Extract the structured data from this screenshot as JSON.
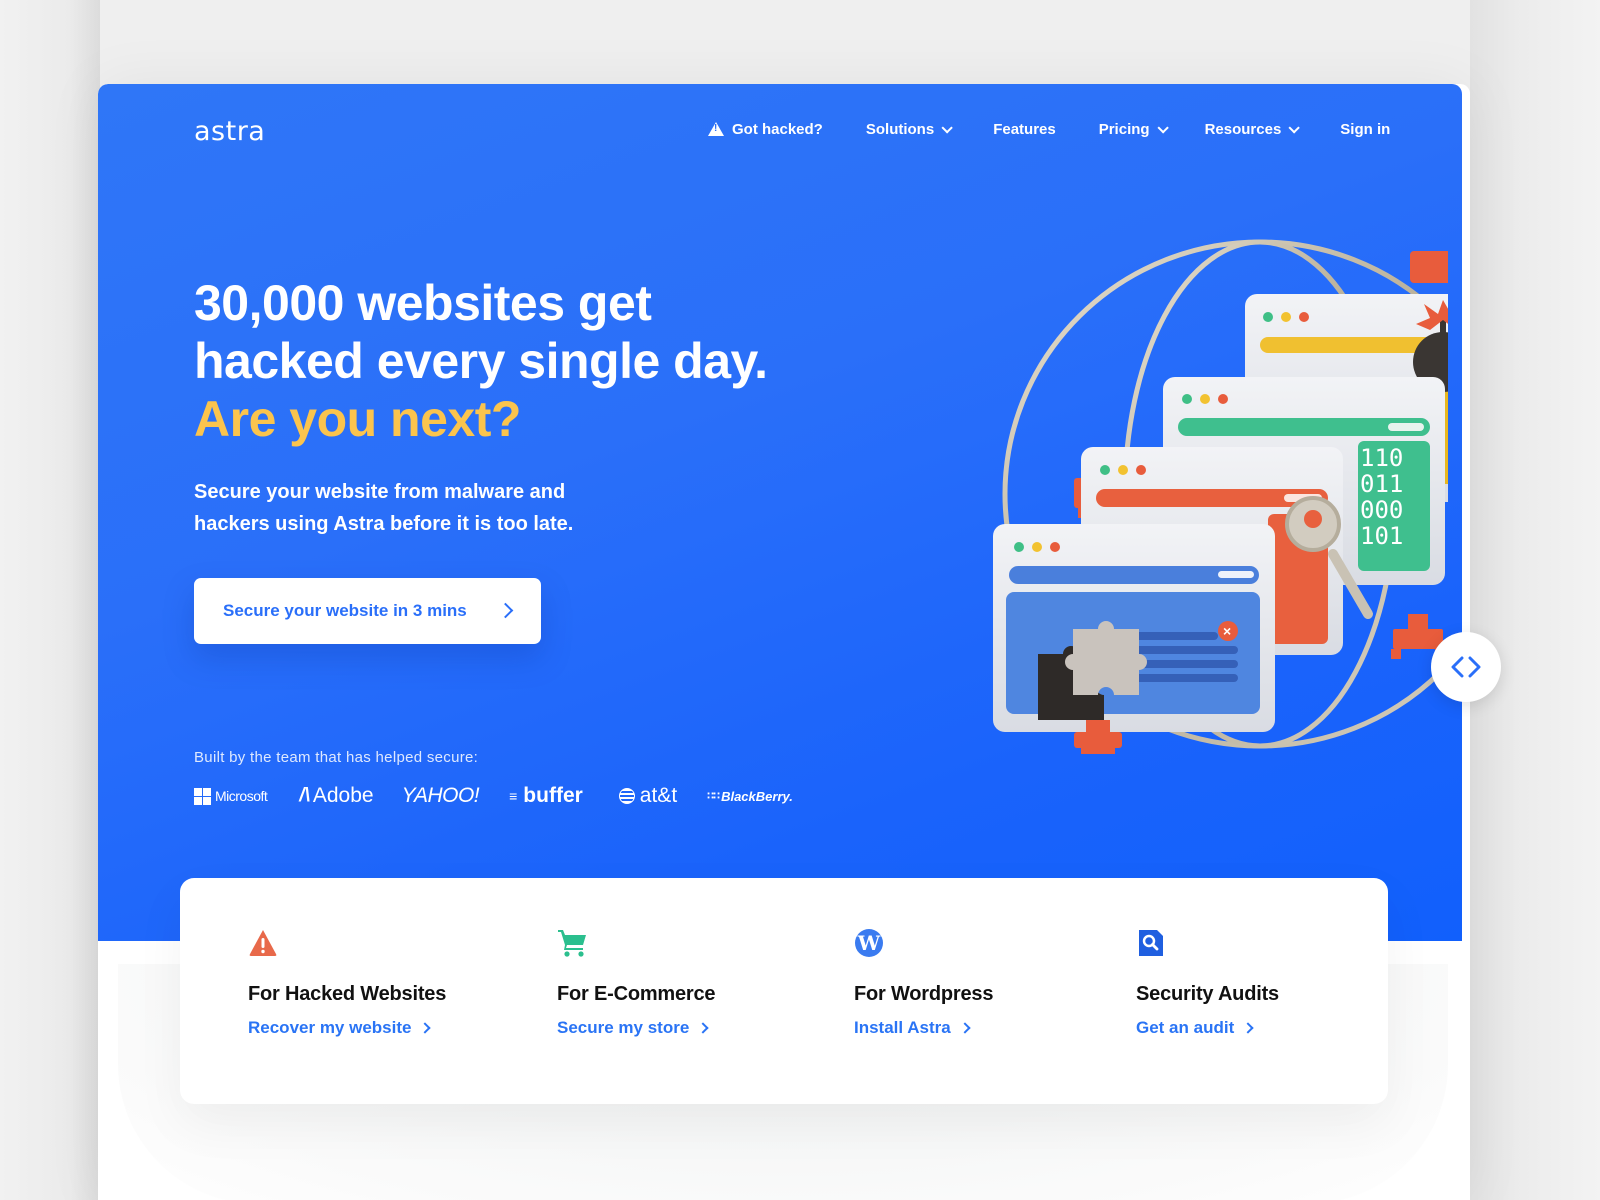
{
  "brand": {
    "name": "astra"
  },
  "nav": {
    "items": [
      {
        "label": "Got hacked?",
        "icon": "warning-icon",
        "dropdown": false
      },
      {
        "label": "Solutions",
        "dropdown": true
      },
      {
        "label": "Features",
        "dropdown": false
      },
      {
        "label": "Pricing",
        "dropdown": true
      },
      {
        "label": "Resources",
        "dropdown": true
      },
      {
        "label": "Sign in",
        "dropdown": false
      }
    ]
  },
  "hero": {
    "headline_line1": "30,000 websites get",
    "headline_line2": "hacked every single day.",
    "headline_accent": "Are you next?",
    "subtext": "Secure your website from malware and hackers using Astra before it is too late.",
    "cta_label": "Secure your website in 3 mins",
    "trust_label": "Built by the team that has helped secure:",
    "logos": [
      "Microsoft",
      "Adobe",
      "YAHOO!",
      "buffer",
      "at&t",
      "BlackBerry."
    ],
    "binary_lines": [
      "110",
      "011",
      "000",
      "101"
    ]
  },
  "colors": {
    "primary_blue": "#2a6ff9",
    "accent_yellow": "#fbc44d",
    "link_blue": "#2a74f5",
    "warning_orange": "#e8694a",
    "cart_green": "#2bbf8e",
    "wordpress_blue": "#3a7bf0",
    "audit_blue": "#1f5fe0"
  },
  "features": [
    {
      "icon": "warning-icon",
      "title": "For Hacked Websites",
      "link": "Recover my website"
    },
    {
      "icon": "shopping-cart-icon",
      "title": "For E-Commerce",
      "link": "Secure my store"
    },
    {
      "icon": "wordpress-icon",
      "title": "For Wordpress",
      "link": "Install Astra"
    },
    {
      "icon": "audit-document-search-icon",
      "title": "Security Audits",
      "link": "Get an audit"
    }
  ],
  "toggle": {
    "icon": "code-brackets-icon"
  }
}
